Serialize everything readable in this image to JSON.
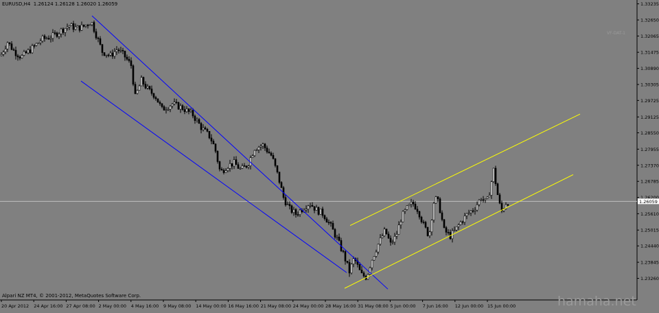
{
  "header": {
    "symbol_text": "EURUSD,H4  1.26124 1.26128 1.26020 1.26059"
  },
  "footer": {
    "broker_text": "Alpari NZ MT4, © 2001-2012, MetaQuotes Software Corp."
  },
  "indicator_label": "VF-DAT-1",
  "watermark": "hamaha.net",
  "colors": {
    "background": "#808080",
    "candle": "#000000",
    "down_channel": "#0000ff",
    "up_channel": "#ffff00",
    "bid_line": "#c0c0c0",
    "axis_text": "#000000"
  },
  "chart_data": {
    "type": "candlestick",
    "symbol": "EURUSD",
    "timeframe": "H4",
    "last_ohlc": {
      "open": 1.26124,
      "high": 1.26128,
      "low": 1.2602,
      "close": 1.26059
    },
    "current_price_label": "1.26059",
    "ylim": [
      1.228,
      1.3325
    ],
    "y_ticks": [
      "1.33235",
      "1.32650",
      "1.32065",
      "1.31475",
      "1.30890",
      "1.30305",
      "1.29725",
      "1.29125",
      "1.28550",
      "1.27955",
      "1.27370",
      "1.26785",
      "1.26200",
      "1.25610",
      "1.25015",
      "1.24440",
      "1.23845",
      "1.23260"
    ],
    "x_ticks": [
      "20 Apr 2012",
      "24 Apr 16:00",
      "27 Apr 08:00",
      "2 May 00:00",
      "4 May 16:00",
      "9 May 08:00",
      "14 May 00:00",
      "16 May 16:00",
      "21 May 08:00",
      "24 May 00:00",
      "28 May 16:00",
      "31 May 08:00",
      "5 Jun 00:00",
      "7 Jun 16:00",
      "12 Jun 00:00",
      "15 Jun 00:00"
    ],
    "price_path": [
      [
        0,
        1.3135
      ],
      [
        10,
        1.3185
      ],
      [
        20,
        1.315
      ],
      [
        30,
        1.313
      ],
      [
        45,
        1.316
      ],
      [
        60,
        1.3195
      ],
      [
        75,
        1.3205
      ],
      [
        90,
        1.323
      ],
      [
        100,
        1.3245
      ],
      [
        110,
        1.3235
      ],
      [
        120,
        1.324
      ],
      [
        132,
        1.326
      ],
      [
        140,
        1.3205
      ],
      [
        148,
        1.315
      ],
      [
        160,
        1.3135
      ],
      [
        170,
        1.316
      ],
      [
        180,
        1.3135
      ],
      [
        190,
        1.31
      ],
      [
        196,
        1.2985
      ],
      [
        205,
        1.3045
      ],
      [
        215,
        1.301
      ],
      [
        225,
        1.299
      ],
      [
        235,
        1.294
      ],
      [
        250,
        1.296
      ],
      [
        265,
        1.2945
      ],
      [
        280,
        1.292
      ],
      [
        292,
        1.2875
      ],
      [
        305,
        1.284
      ],
      [
        312,
        1.28
      ],
      [
        320,
        1.271
      ],
      [
        330,
        1.2735
      ],
      [
        340,
        1.2745
      ],
      [
        350,
        1.272
      ],
      [
        360,
        1.274
      ],
      [
        370,
        1.28
      ],
      [
        382,
        1.281
      ],
      [
        395,
        1.277
      ],
      [
        405,
        1.269
      ],
      [
        412,
        1.262
      ],
      [
        420,
        1.258
      ],
      [
        430,
        1.256
      ],
      [
        440,
        1.258
      ],
      [
        450,
        1.26
      ],
      [
        460,
        1.2575
      ],
      [
        470,
        1.256
      ],
      [
        480,
        1.252
      ],
      [
        490,
        1.247
      ],
      [
        500,
        1.241
      ],
      [
        508,
        1.235
      ],
      [
        515,
        1.24
      ],
      [
        525,
        1.234
      ],
      [
        533,
        1.233
      ],
      [
        540,
        1.239
      ],
      [
        550,
        1.245
      ],
      [
        560,
        1.25
      ],
      [
        568,
        1.245
      ],
      [
        576,
        1.248
      ],
      [
        584,
        1.255
      ],
      [
        592,
        1.258
      ],
      [
        600,
        1.26
      ],
      [
        608,
        1.2575
      ],
      [
        616,
        1.252
      ],
      [
        624,
        1.248
      ],
      [
        632,
        1.262
      ],
      [
        638,
        1.26
      ],
      [
        646,
        1.25
      ],
      [
        655,
        1.248
      ],
      [
        662,
        1.25
      ],
      [
        670,
        1.253
      ],
      [
        680,
        1.256
      ],
      [
        690,
        1.258
      ],
      [
        700,
        1.262
      ],
      [
        708,
        1.26
      ],
      [
        713,
        1.265
      ],
      [
        718,
        1.272
      ],
      [
        722,
        1.266
      ],
      [
        726,
        1.26
      ],
      [
        730,
        1.257
      ],
      [
        736,
        1.26
      ],
      [
        740,
        1.2606
      ]
    ],
    "channels": [
      {
        "color": "down_channel",
        "lines": [
          [
            [
              134,
              1.328
            ],
            [
              565,
              1.2287
            ]
          ],
          [
            [
              118,
              1.3043
            ],
            [
              505,
              1.2347
            ]
          ]
        ]
      },
      {
        "color": "up_channel",
        "lines": [
          [
            [
              510,
              1.2518
            ],
            [
              845,
              1.2923
            ]
          ],
          [
            [
              502,
              1.229
            ],
            [
              835,
              1.2703
            ]
          ]
        ]
      }
    ]
  }
}
